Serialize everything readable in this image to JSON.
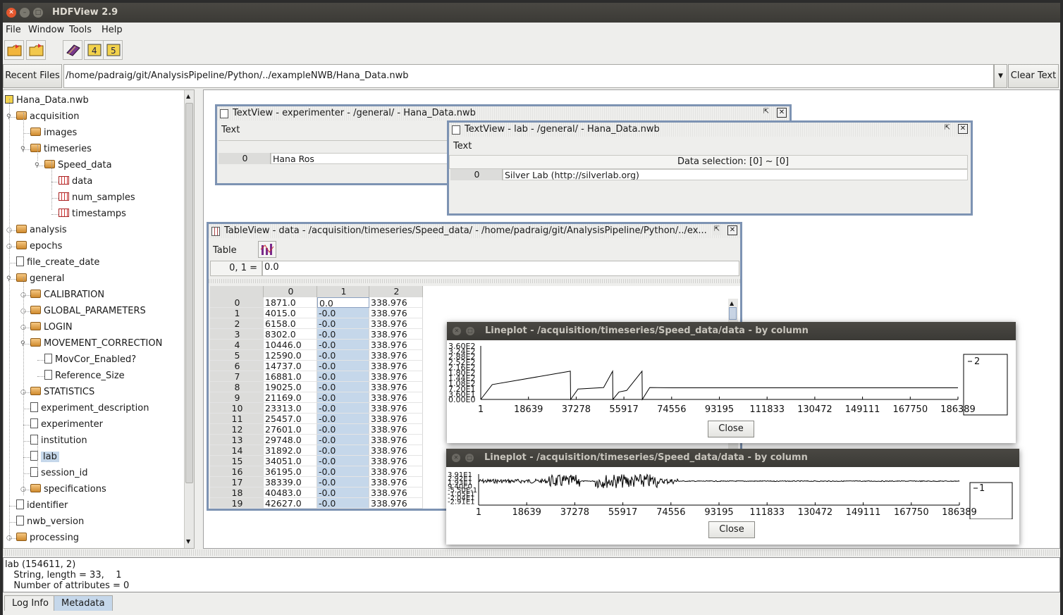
{
  "window": {
    "title": "HDFView 2.9"
  },
  "menu": [
    "File",
    "Window",
    "Tools",
    "Help"
  ],
  "toolbar": {
    "icons": [
      "open-file-icon",
      "open-folder-icon",
      "help-book-icon",
      "hdf4-icon",
      "hdf5-icon"
    ]
  },
  "urlbar": {
    "recent_label": "Recent Files",
    "path": "/home/padraig/git/AnalysisPipeline/Python/../exampleNWB/Hana_Data.nwb",
    "clear_label": "Clear Text"
  },
  "tree": {
    "root": "Hana_Data.nwb",
    "nodes": [
      {
        "label": "acquisition",
        "type": "folder",
        "depth": 1,
        "expanded": true
      },
      {
        "label": "images",
        "type": "folder",
        "depth": 2
      },
      {
        "label": "timeseries",
        "type": "folder",
        "depth": 2,
        "expanded": true
      },
      {
        "label": "Speed_data",
        "type": "folder",
        "depth": 3,
        "expanded": true
      },
      {
        "label": "data",
        "type": "dataset",
        "depth": 4
      },
      {
        "label": "num_samples",
        "type": "dataset",
        "depth": 4
      },
      {
        "label": "timestamps",
        "type": "dataset",
        "depth": 4
      },
      {
        "label": "analysis",
        "type": "folder",
        "depth": 1,
        "collapsed": true
      },
      {
        "label": "epochs",
        "type": "folder",
        "depth": 1,
        "collapsed": true
      },
      {
        "label": "file_create_date",
        "type": "file",
        "depth": 1
      },
      {
        "label": "general",
        "type": "folder",
        "depth": 1,
        "expanded": true
      },
      {
        "label": "CALIBRATION",
        "type": "folder",
        "depth": 2,
        "collapsed": true
      },
      {
        "label": "GLOBAL_PARAMETERS",
        "type": "folder",
        "depth": 2,
        "collapsed": true
      },
      {
        "label": "LOGIN",
        "type": "folder",
        "depth": 2,
        "collapsed": true
      },
      {
        "label": "MOVEMENT_CORRECTION",
        "type": "folder",
        "depth": 2,
        "expanded": true
      },
      {
        "label": "MovCor_Enabled?",
        "type": "file",
        "depth": 3
      },
      {
        "label": "Reference_Size",
        "type": "file",
        "depth": 3
      },
      {
        "label": "STATISTICS",
        "type": "folder",
        "depth": 2,
        "collapsed": true
      },
      {
        "label": "experiment_description",
        "type": "file",
        "depth": 2
      },
      {
        "label": "experimenter",
        "type": "file",
        "depth": 2
      },
      {
        "label": "institution",
        "type": "file",
        "depth": 2
      },
      {
        "label": "lab",
        "type": "file",
        "depth": 2,
        "selected": true
      },
      {
        "label": "session_id",
        "type": "file",
        "depth": 2
      },
      {
        "label": "specifications",
        "type": "folder",
        "depth": 2,
        "collapsed": true
      },
      {
        "label": "identifier",
        "type": "file",
        "depth": 1
      },
      {
        "label": "nwb_version",
        "type": "file",
        "depth": 1
      },
      {
        "label": "processing",
        "type": "folder",
        "depth": 1,
        "collapsed": true
      }
    ]
  },
  "textview1": {
    "title": "TextView  -  experimenter  -  /general/  -  Hana_Data.nwb",
    "menu": "Text",
    "row_index": "0",
    "value": "Hana Ros"
  },
  "textview2": {
    "title": "TextView  -  lab  -  /general/  -  Hana_Data.nwb",
    "menu": "Text",
    "selection": "Data selection:   [0] ~ [0]",
    "row_index": "0",
    "value": "Silver Lab (http://silverlab.org)"
  },
  "tableview": {
    "title": "TableView  -  data  -  /acquisition/timeseries/Speed_data/  -  /home/padraig/git/AnalysisPipeline/Python/../ex...",
    "menu": "Table",
    "cell_ref": "0, 1  =",
    "cell_value": "0.0",
    "columns": [
      "0",
      "1",
      "2"
    ],
    "rows": [
      [
        "0",
        "1871.0",
        "0.0",
        "338.976"
      ],
      [
        "1",
        "4015.0",
        "-0.0",
        "338.976"
      ],
      [
        "2",
        "6158.0",
        "-0.0",
        "338.976"
      ],
      [
        "3",
        "8302.0",
        "-0.0",
        "338.976"
      ],
      [
        "4",
        "10446.0",
        "-0.0",
        "338.976"
      ],
      [
        "5",
        "12590.0",
        "-0.0",
        "338.976"
      ],
      [
        "6",
        "14737.0",
        "-0.0",
        "338.976"
      ],
      [
        "7",
        "16881.0",
        "-0.0",
        "338.976"
      ],
      [
        "8",
        "19025.0",
        "-0.0",
        "338.976"
      ],
      [
        "9",
        "21169.0",
        "-0.0",
        "338.976"
      ],
      [
        "10",
        "23313.0",
        "-0.0",
        "338.976"
      ],
      [
        "11",
        "25457.0",
        "-0.0",
        "338.976"
      ],
      [
        "12",
        "27601.0",
        "-0.0",
        "338.976"
      ],
      [
        "13",
        "29748.0",
        "-0.0",
        "338.976"
      ],
      [
        "14",
        "31892.0",
        "-0.0",
        "338.976"
      ],
      [
        "15",
        "34051.0",
        "-0.0",
        "338.976"
      ],
      [
        "16",
        "36195.0",
        "-0.0",
        "338.976"
      ],
      [
        "17",
        "38339.0",
        "-0.0",
        "338.976"
      ],
      [
        "18",
        "40483.0",
        "-0.0",
        "338.976"
      ],
      [
        "19",
        "42627.0",
        "-0.0",
        "338.976"
      ]
    ]
  },
  "plot1": {
    "title": "Lineplot - /acquisition/timeseries/Speed_data/data - by column",
    "x_ticks": [
      "1",
      "18639",
      "37278",
      "55917",
      "74556",
      "93195",
      "111833",
      "130472",
      "149111",
      "167750",
      "186389"
    ],
    "y_ticks": [
      "3.60E2",
      "3.24E2",
      "2.88E2",
      "2.52E2",
      "2.16E2",
      "1.80E2",
      "1.44E2",
      "1.08E2",
      "7.20E1",
      "3.60E1",
      "0.00E0"
    ],
    "legend": "2",
    "close_label": "Close"
  },
  "plot2": {
    "title": "Lineplot - /acquisition/timeseries/Speed_data/data - by column",
    "x_ticks": [
      "1",
      "18639",
      "37278",
      "55917",
      "74556",
      "93195",
      "111833",
      "130472",
      "149111",
      "167750",
      "186389"
    ],
    "y_ticks": [
      "3.91E1",
      "2.92E1",
      "1.93E1",
      "9.40E0",
      "-5.50E-1",
      "-1.05E1",
      "-2.04E1",
      "-2.91E1"
    ],
    "legend": "1",
    "close_label": "Close"
  },
  "chart_data": [
    {
      "type": "line",
      "title": "Lineplot - /acquisition/timeseries/Speed_data/data - by column",
      "series": [
        {
          "name": "2",
          "x": [
            1,
            4500,
            35000,
            35100,
            38000,
            48000,
            51500,
            51600,
            54000,
            57000,
            63000,
            63100,
            66000,
            75000,
            186389
          ],
          "y": [
            0,
            100,
            190,
            0,
            70,
            80,
            190,
            0,
            50,
            60,
            190,
            0,
            80,
            78,
            78
          ]
        }
      ],
      "ylim": [
        0,
        360
      ],
      "xlim": [
        1,
        186389
      ]
    },
    {
      "type": "line",
      "title": "Lineplot - /acquisition/timeseries/Speed_data/data - by column",
      "series": [
        {
          "name": "1",
          "x": [
            1,
            186389
          ],
          "y": [
            0,
            0
          ]
        }
      ],
      "xlim": [
        1,
        186389
      ]
    }
  ],
  "status": {
    "line1": "lab (154611, 2)",
    "line2": "   String, length = 33,    1",
    "line3": "   Number of attributes = 0"
  },
  "bottom_tabs": [
    "Log Info",
    "Metadata"
  ]
}
